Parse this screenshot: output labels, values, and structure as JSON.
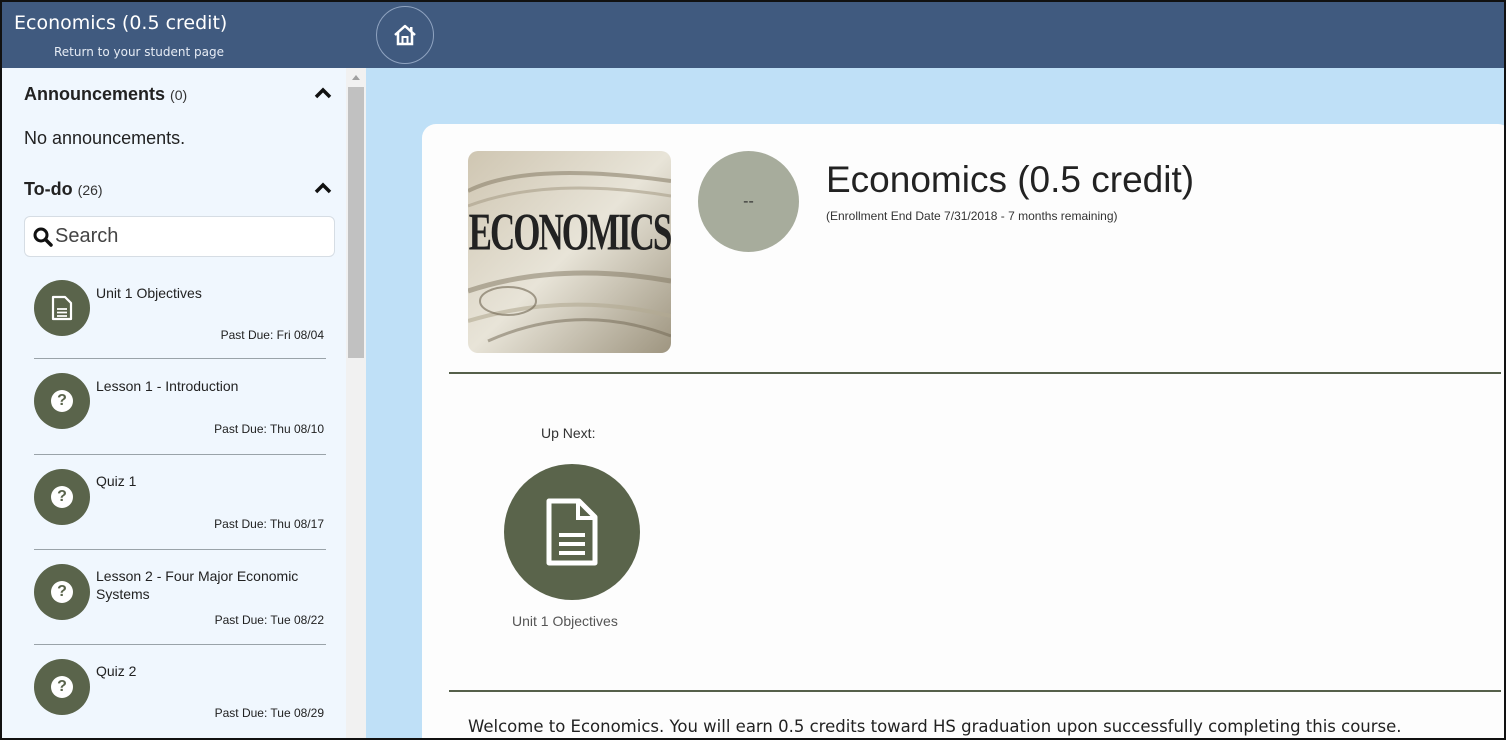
{
  "header": {
    "course_title": "Economics (0.5 credit)",
    "return_link": "Return to your student page",
    "home_icon": "home-icon"
  },
  "sidebar": {
    "announcements": {
      "title": "Announcements",
      "count": "(0)",
      "empty_text": "No announcements."
    },
    "todo": {
      "title": "To-do",
      "count": "(26)",
      "search_placeholder": "Search",
      "items": [
        {
          "title": "Unit 1 Objectives",
          "due": "Past Due: Fri 08/04",
          "icon": "document-icon"
        },
        {
          "title": "Lesson 1 - Introduction",
          "due": "Past Due: Thu 08/10",
          "icon": "question-icon"
        },
        {
          "title": "Quiz 1",
          "due": "Past Due: Thu 08/17",
          "icon": "question-icon"
        },
        {
          "title": "Lesson 2 - Four Major Economic Systems",
          "due": "Past Due: Tue 08/22",
          "icon": "question-icon"
        },
        {
          "title": "Quiz 2",
          "due": "Past Due: Tue 08/29",
          "icon": "question-icon"
        }
      ]
    }
  },
  "main": {
    "course_image_text": "ECONOMICS",
    "grade": "--",
    "title": "Economics (0.5 credit)",
    "enrollment": "(Enrollment End Date 7/31/2018 - 7 months remaining)",
    "up_next_label": "Up Next:",
    "up_next_item": "Unit 1 Objectives",
    "welcome": "Welcome to Economics. You will earn 0.5 credits toward HS graduation upon successfully completing this course."
  },
  "colors": {
    "header_bg": "#405a7f",
    "sidebar_bg": "#f0f7fe",
    "page_bg": "#bfe0f7",
    "icon_green": "#5a644b",
    "grade_circle": "#a7ac9c"
  }
}
